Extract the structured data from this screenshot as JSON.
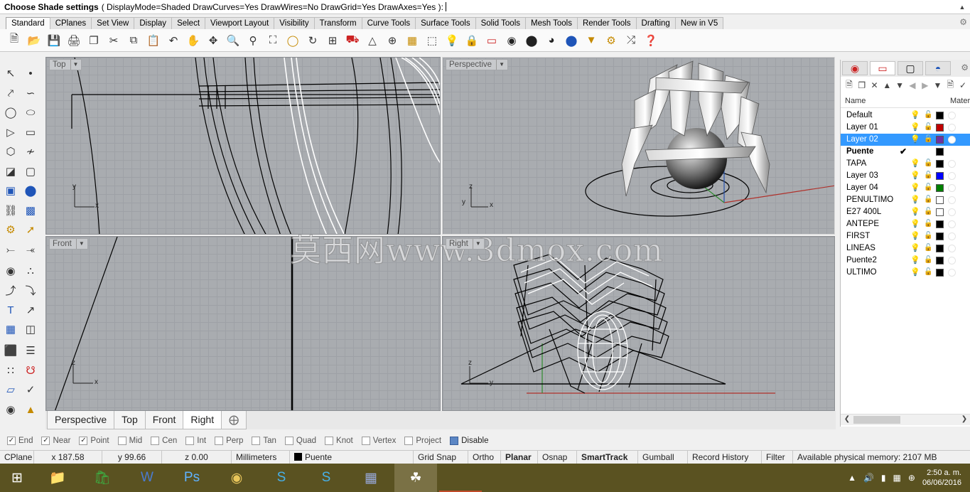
{
  "command": {
    "title": "Choose Shade settings",
    "options": "( DisplayMode=Shaded  DrawCurves=Yes  DrawWires=No  DrawGrid=Yes  DrawAxes=Yes ):"
  },
  "toolbar_tabs": [
    "Standard",
    "CPlanes",
    "Set View",
    "Display",
    "Select",
    "Viewport Layout",
    "Visibility",
    "Transform",
    "Curve Tools",
    "Surface Tools",
    "Solid Tools",
    "Mesh Tools",
    "Render Tools",
    "Drafting",
    "New in V5"
  ],
  "viewports": {
    "top": {
      "title": "Top"
    },
    "perspective": {
      "title": "Perspective"
    },
    "front": {
      "title": "Front"
    },
    "right": {
      "title": "Right"
    }
  },
  "viewport_tabs": [
    "Perspective",
    "Top",
    "Front",
    "Right"
  ],
  "watermark": "莫西网www.3dmox.com",
  "layers_panel": {
    "col_name": "Name",
    "col_material": "Mater",
    "layers": [
      {
        "name": "Default",
        "color": "#000000",
        "bulb": "#e8c000"
      },
      {
        "name": "Layer 01",
        "color": "#c00000",
        "bulb": "#e8c000"
      },
      {
        "name": "Layer 02",
        "color": "#7030a0",
        "bulb": "#e8c000",
        "selected": true
      },
      {
        "name": "Puente",
        "color": "#000000",
        "bulb": "",
        "current": true
      },
      {
        "name": "TAPA",
        "color": "#000000",
        "bulb": "#e8c000"
      },
      {
        "name": "Layer 03",
        "color": "#0000ff",
        "bulb": "#3a7ad8"
      },
      {
        "name": "Layer 04",
        "color": "#008000",
        "bulb": "#3a7ad8"
      },
      {
        "name": "PENULTIMO",
        "color": "#ffffff",
        "bulb": "#e8c000"
      },
      {
        "name": "E27 400L",
        "color": "#ffffff",
        "bulb": "#3a7ad8"
      },
      {
        "name": "ANTEPE",
        "color": "#000000",
        "bulb": "#e8c000"
      },
      {
        "name": "FIRST",
        "color": "#000000",
        "bulb": "#e8c000"
      },
      {
        "name": "LINEAS",
        "color": "#000000",
        "bulb": "#3a7ad8"
      },
      {
        "name": "Puente2",
        "color": "#000000",
        "bulb": "#3a7ad8"
      },
      {
        "name": "ULTIMO",
        "color": "#000000",
        "bulb": "#e8c000"
      }
    ]
  },
  "osnaps": [
    {
      "label": "End",
      "checked": true
    },
    {
      "label": "Near",
      "checked": true
    },
    {
      "label": "Point",
      "checked": true
    },
    {
      "label": "Mid",
      "checked": false
    },
    {
      "label": "Cen",
      "checked": false
    },
    {
      "label": "Int",
      "checked": false
    },
    {
      "label": "Perp",
      "checked": false
    },
    {
      "label": "Tan",
      "checked": false
    },
    {
      "label": "Quad",
      "checked": false
    },
    {
      "label": "Knot",
      "checked": false
    },
    {
      "label": "Vertex",
      "checked": false
    },
    {
      "label": "Project",
      "checked": false
    },
    {
      "label": "Disable",
      "checked": false
    }
  ],
  "status": {
    "cplane": "CPlane",
    "x": "x 187.58",
    "y": "y 99.66",
    "z": "z 0.00",
    "units": "Millimeters",
    "layer": "Puente",
    "grid_snap": "Grid Snap",
    "ortho": "Ortho",
    "planar": "Planar",
    "osnap": "Osnap",
    "smarttrack": "SmartTrack",
    "gumball": "Gumball",
    "record_history": "Record History",
    "filter": "Filter",
    "memory": "Available physical memory: 2107 MB"
  },
  "clock": {
    "time": "2:50 a. m.",
    "date": "06/06/2016"
  },
  "colors": {
    "accent": "#3399ff",
    "viewport_bg": "#a9acb0",
    "taskbar": "#5a5221"
  }
}
